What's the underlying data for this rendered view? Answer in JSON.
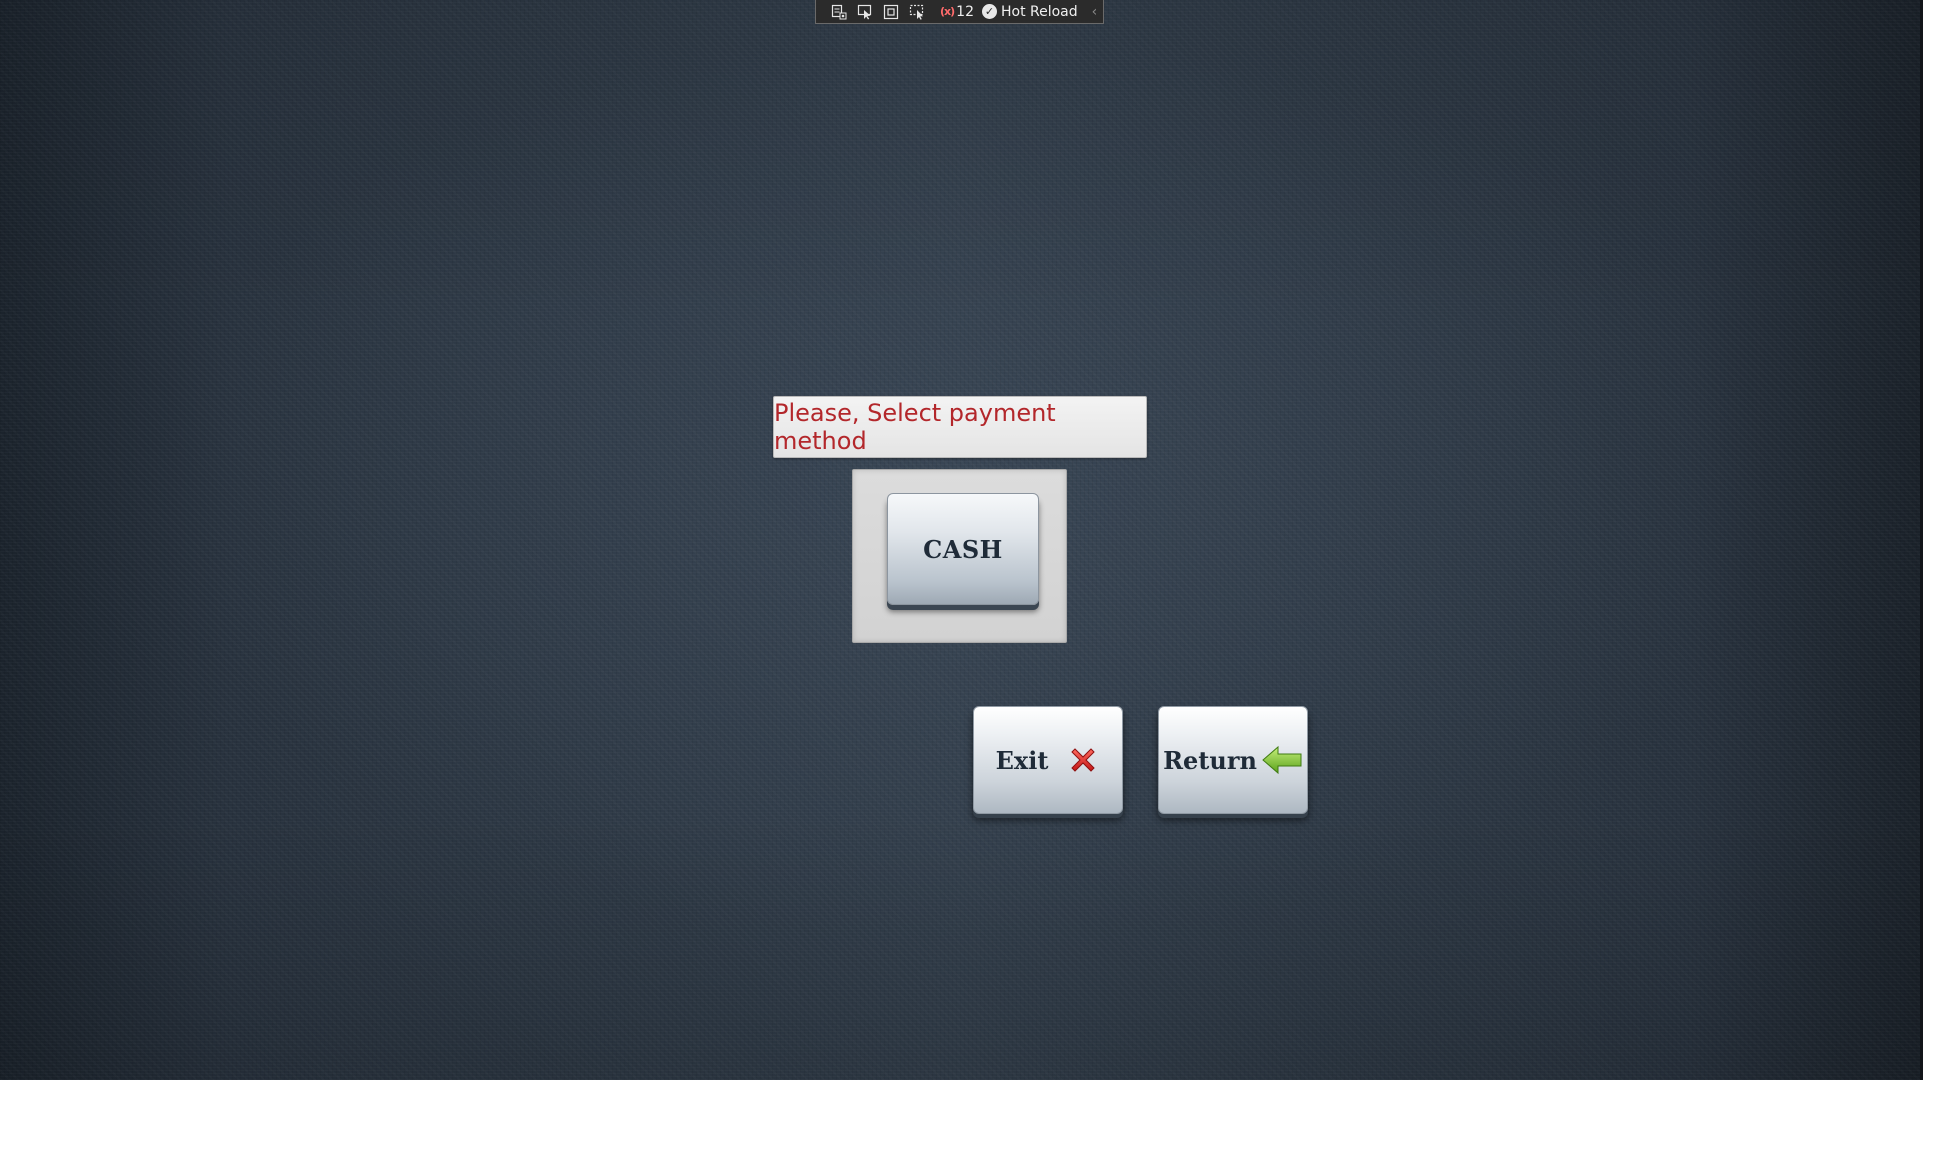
{
  "debug_toolbar": {
    "tools": [
      {
        "icon": "go-to-live-visual-tree-icon"
      },
      {
        "icon": "select-element-icon"
      },
      {
        "icon": "display-layout-adorners-icon"
      },
      {
        "icon": "track-focused-element-icon"
      }
    ],
    "binding_failures_count": "12",
    "binding_failures_icon": "binding-failures-icon",
    "hot_reload_icon": "check-circle-icon",
    "hot_reload_label": "Hot Reload",
    "collapse_icon": "chevron-left-icon"
  },
  "prompt": {
    "text": "Please, Select payment method",
    "color": "#b3272b"
  },
  "payment_methods": [
    {
      "label": "CASH"
    }
  ],
  "actions": {
    "exit_label": "Exit",
    "exit_icon": "red-x-icon",
    "return_label": "Return",
    "return_icon": "green-left-arrow-icon"
  },
  "colors": {
    "background": "#2e3946",
    "button_text": "#1f2b38",
    "exit_icon": "#d62a2a",
    "return_icon": "#7dc42a"
  }
}
